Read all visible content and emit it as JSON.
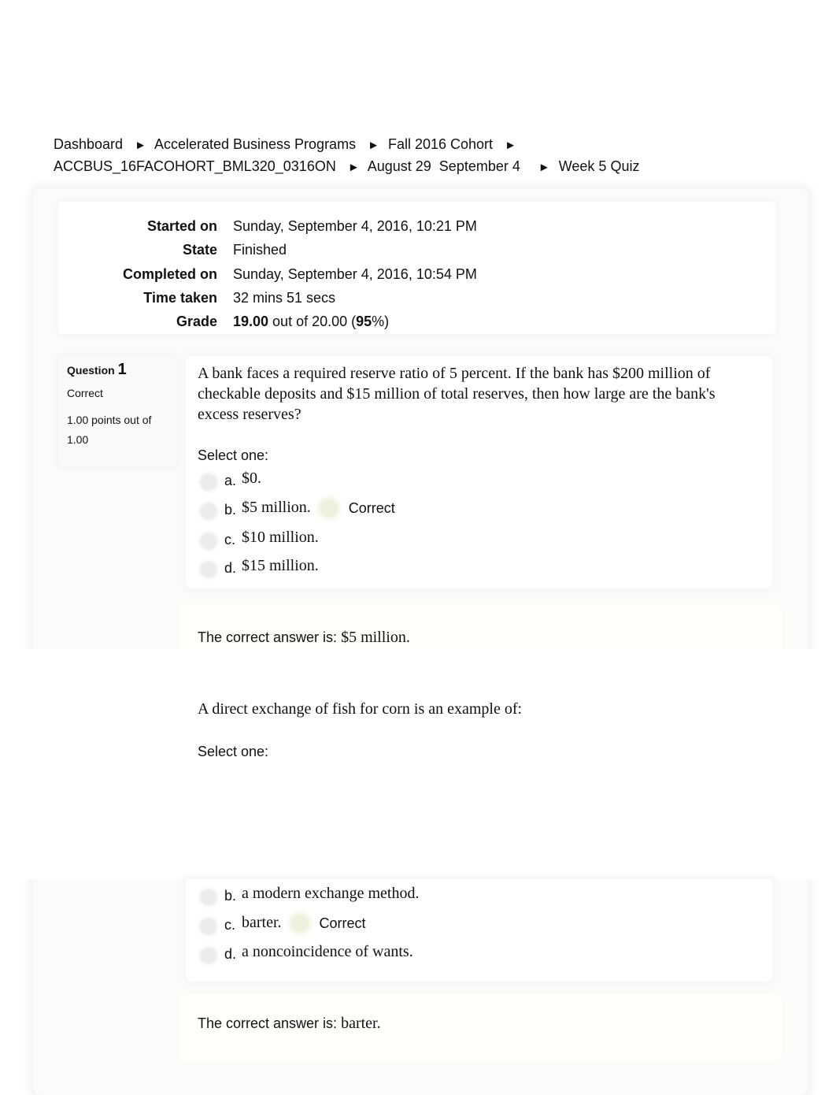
{
  "breadcrumb": {
    "items": [
      "Dashboard",
      "Accelerated Business Programs",
      "Fall 2016 Cohort",
      "ACCBUS_16FACOHORT_BML320_0316ON",
      "August 29  September 4",
      "Week 5 Quiz"
    ],
    "separator": "►"
  },
  "summary": {
    "rows": [
      {
        "label": "Started on",
        "value": "Sunday, September 4, 2016, 10:21 PM"
      },
      {
        "label": "State",
        "value": "Finished"
      },
      {
        "label": "Completed on",
        "value": "Sunday, September 4, 2016, 10:54 PM"
      },
      {
        "label": "Time taken",
        "value": "32 mins 51 secs"
      },
      {
        "label": "Grade",
        "value_bold": "19.00",
        "value_mid": " out of 20.00 (",
        "value_pct": "95",
        "value_end": "%)"
      }
    ]
  },
  "questions": [
    {
      "label": "Question",
      "number": "1",
      "state": "Correct",
      "grade": "1.00 points out of 1.00",
      "text": "A bank faces a required reserve ratio of 5 percent. If the bank has $200 million of checkable deposits and $15 million of total reserves, then how large are the bank's excess reserves?",
      "prompt": "Select one:",
      "answers": [
        {
          "letter": "a.",
          "text": "$0.",
          "feedback": ""
        },
        {
          "letter": "b.",
          "text": "$5 million.",
          "feedback": "Correct"
        },
        {
          "letter": "c.",
          "text": "$10 million.",
          "feedback": ""
        },
        {
          "letter": "d.",
          "text": "$15 million.",
          "feedback": ""
        }
      ],
      "right_answer_label": "The correct answer is: ",
      "right_answer": "$5 million."
    },
    {
      "text": "A direct exchange of fish for corn is an example of:",
      "prompt": "Select one:",
      "answers": [
        {
          "letter": "b.",
          "text": "a modern exchange method.",
          "feedback": ""
        },
        {
          "letter": "c.",
          "text": "barter.",
          "feedback": "Correct"
        },
        {
          "letter": "d.",
          "text": "a noncoincidence of wants.",
          "feedback": ""
        }
      ],
      "right_answer_label": "The correct answer is: ",
      "right_answer": "barter."
    }
  ]
}
